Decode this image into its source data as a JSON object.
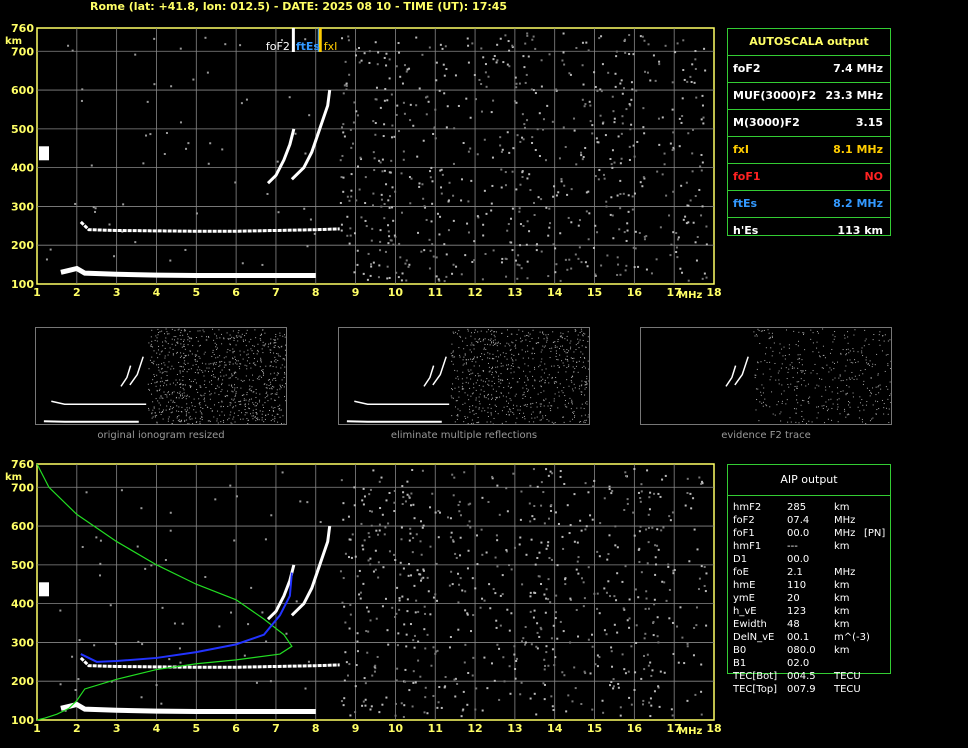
{
  "header": {
    "title": "Rome (lat: +41.8, lon: 012.5) - DATE: 2025 08 10 - TIME (UT): 17:45"
  },
  "chart_data": {
    "type": "scatter",
    "xlabel": "MHz",
    "ylabel": "km",
    "xlim": [
      1,
      18
    ],
    "ylim": [
      100,
      760
    ],
    "x_ticks": [
      "1",
      "2",
      "3",
      "4",
      "5",
      "6",
      "7",
      "8",
      "9",
      "10",
      "11",
      "12",
      "13",
      "14",
      "15",
      "16",
      "17",
      "18"
    ],
    "y_ticks": [
      "760",
      "700",
      "600",
      "500",
      "400",
      "300",
      "200",
      "100"
    ],
    "grid": true,
    "markers": [
      {
        "label": "foF2",
        "x": 7.4,
        "color": "#ffffff"
      },
      {
        "label": "ftEs",
        "x": 8.2,
        "color": "#3399ff"
      },
      {
        "label": "fxI",
        "x": 8.1,
        "color": "#ffcc00"
      }
    ],
    "traces": {
      "Es_layer": [
        [
          1.6,
          130
        ],
        [
          1.8,
          135
        ],
        [
          2.0,
          140
        ],
        [
          2.2,
          128
        ],
        [
          3,
          125
        ],
        [
          4,
          123
        ],
        [
          5,
          122
        ],
        [
          6,
          122
        ],
        [
          7,
          122
        ],
        [
          8,
          122
        ]
      ],
      "E_layer": [
        [
          2.1,
          260
        ],
        [
          2.3,
          240
        ],
        [
          3,
          238
        ],
        [
          4,
          237
        ],
        [
          5,
          236
        ],
        [
          6,
          236
        ],
        [
          7,
          238
        ],
        [
          8,
          240
        ],
        [
          8.6,
          242
        ]
      ],
      "F2_o_trace": [
        [
          6.8,
          360
        ],
        [
          7.0,
          380
        ],
        [
          7.2,
          420
        ],
        [
          7.35,
          460
        ],
        [
          7.45,
          500
        ]
      ],
      "F2_x_trace": [
        [
          7.4,
          370
        ],
        [
          7.7,
          400
        ],
        [
          7.9,
          440
        ],
        [
          8.1,
          500
        ],
        [
          8.3,
          560
        ],
        [
          8.35,
          600
        ]
      ],
      "profile_trace": [
        [
          2.1,
          270
        ],
        [
          2.5,
          250
        ],
        [
          3,
          252
        ],
        [
          4,
          260
        ],
        [
          5,
          275
        ],
        [
          6,
          295
        ],
        [
          6.7,
          320
        ],
        [
          7.1,
          370
        ],
        [
          7.35,
          420
        ],
        [
          7.4,
          480
        ]
      ],
      "electron_density_profile": [
        [
          1,
          760
        ],
        [
          1.3,
          700
        ],
        [
          2,
          630
        ],
        [
          3,
          560
        ],
        [
          4,
          500
        ],
        [
          5,
          450
        ],
        [
          6,
          410
        ],
        [
          6.7,
          360
        ],
        [
          7.2,
          320
        ],
        [
          7.4,
          290
        ],
        [
          7.1,
          270
        ],
        [
          6.0,
          255
        ],
        [
          5.0,
          245
        ],
        [
          4.0,
          230
        ],
        [
          3.0,
          205
        ],
        [
          2.2,
          180
        ],
        [
          2.0,
          150
        ],
        [
          1.8,
          130
        ],
        [
          1.5,
          115
        ],
        [
          1.2,
          105
        ],
        [
          1,
          100
        ]
      ]
    }
  },
  "autoscala": {
    "title": "AUTOSCALA output",
    "rows": [
      {
        "label": "foF2",
        "value": "7.4 MHz",
        "color": "#ffffff"
      },
      {
        "label": "MUF(3000)F2",
        "value": "23.3 MHz",
        "color": "#ffffff"
      },
      {
        "label": "M(3000)F2",
        "value": "3.15",
        "color": "#ffffff"
      },
      {
        "label": "fxI",
        "value": "8.1 MHz",
        "color": "#ffcc00"
      },
      {
        "label": "foF1",
        "value": "NO",
        "color": "#ff2222"
      },
      {
        "label": "ftEs",
        "value": "8.2 MHz",
        "color": "#3399ff"
      },
      {
        "label": "h'Es",
        "value": "113    km",
        "color": "#ffffff"
      }
    ]
  },
  "thumbnails": [
    {
      "caption": "original ionogram resized"
    },
    {
      "caption": "eliminate multiple reflections"
    },
    {
      "caption": "evidence F2 trace"
    }
  ],
  "aip": {
    "title": "AIP output",
    "rows": [
      [
        "hmF2",
        "285",
        "km",
        ""
      ],
      [
        "foF2",
        "07.4",
        "MHz",
        ""
      ],
      [
        "foF1",
        "00.0",
        "MHz",
        "[PN]"
      ],
      [
        "hmF1",
        "---",
        "km",
        ""
      ],
      [
        "D1",
        "00.0",
        "",
        ""
      ],
      [
        "foE",
        "2.1",
        "MHz",
        ""
      ],
      [
        "hmE",
        "110",
        "km",
        ""
      ],
      [
        "ymE",
        "20",
        "km",
        ""
      ],
      [
        "h_vE",
        "123",
        "km",
        ""
      ],
      [
        "Ewidth",
        "48",
        "km",
        ""
      ],
      [
        "DelN_vE",
        "00.1",
        "m^(-3)",
        ""
      ],
      [
        "B0",
        "080.0",
        "km",
        ""
      ],
      [
        "B1",
        "02.0",
        "",
        ""
      ],
      [
        "TEC[Bot]",
        "004.5",
        "TECU",
        ""
      ],
      [
        "TEC[Top]",
        "007.9",
        "TECU",
        ""
      ]
    ]
  }
}
